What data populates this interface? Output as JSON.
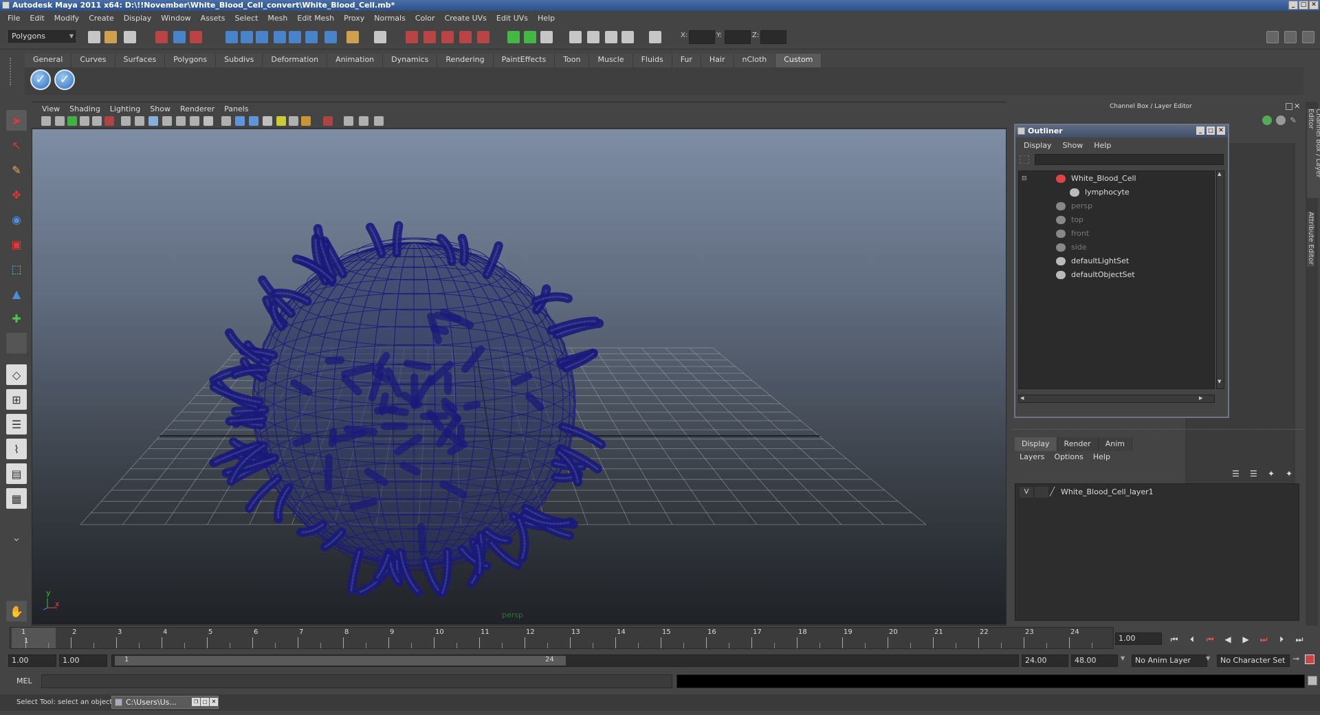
{
  "window": {
    "title": "Autodesk Maya 2011 x64: D:\\!!November\\White_Blood_Cell_convert\\White_Blood_Cell.mb*"
  },
  "menus": [
    "File",
    "Edit",
    "Modify",
    "Create",
    "Display",
    "Window",
    "Assets",
    "Select",
    "Mesh",
    "Edit Mesh",
    "Proxy",
    "Normals",
    "Color",
    "Create UVs",
    "Edit UVs",
    "Help"
  ],
  "status": {
    "mode_menu": "Polygons",
    "x_label": "X:",
    "y_label": "Y:",
    "z_label": "Z:"
  },
  "shelf": {
    "tabs": [
      "General",
      "Curves",
      "Surfaces",
      "Polygons",
      "Subdivs",
      "Deformation",
      "Animation",
      "Dynamics",
      "Rendering",
      "PaintEffects",
      "Toon",
      "Muscle",
      "Fluids",
      "Fur",
      "Hair",
      "nCloth",
      "Custom"
    ],
    "active_tab": "Custom"
  },
  "viewport": {
    "menus": [
      "View",
      "Shading",
      "Lighting",
      "Show",
      "Renderer",
      "Panels"
    ],
    "camera_label": "persp",
    "axis_x": "x",
    "axis_y": "y",
    "wire_color": "#1b1a7a"
  },
  "channel_box": {
    "title": "Channel Box / Layer Editor"
  },
  "side_tabs": [
    "Channel Box / Layer Editor",
    "Attribute Editor"
  ],
  "outliner": {
    "title": "Outliner",
    "menus": [
      "Display",
      "Show",
      "Help"
    ],
    "items": [
      {
        "label": "White_Blood_Cell",
        "dim": false
      },
      {
        "label": "lymphocyte",
        "dim": false
      },
      {
        "label": "persp",
        "dim": true
      },
      {
        "label": "top",
        "dim": true
      },
      {
        "label": "front",
        "dim": true
      },
      {
        "label": "side",
        "dim": true
      },
      {
        "label": "defaultLightSet",
        "dim": false
      },
      {
        "label": "defaultObjectSet",
        "dim": false
      }
    ]
  },
  "layer_editor": {
    "tabs": [
      "Display",
      "Render",
      "Anim"
    ],
    "active_tab": "Display",
    "menus": [
      "Layers",
      "Options",
      "Help"
    ],
    "layers": [
      {
        "visible": "V",
        "name": "White_Blood_Cell_layer1"
      }
    ]
  },
  "timeline": {
    "ticks": [
      "1",
      "2",
      "3",
      "4",
      "5",
      "6",
      "7",
      "8",
      "9",
      "10",
      "11",
      "12",
      "13",
      "14",
      "15",
      "16",
      "17",
      "18",
      "19",
      "20",
      "21",
      "22",
      "23",
      "24"
    ],
    "current_frame": "1.00",
    "current_marker": "1"
  },
  "range": {
    "start": "1.00",
    "playback_start": "1.00",
    "slider_start": "1",
    "slider_end": "24",
    "playback_end": "24.00",
    "end": "48.00",
    "anim_layer": "No Anim Layer",
    "character_set": "No Character Set"
  },
  "command_line": {
    "label": "MEL",
    "value": ""
  },
  "help_line": {
    "text": "Select Tool: select an object"
  },
  "taskbar": {
    "item": "C:\\Users\\Us..."
  }
}
